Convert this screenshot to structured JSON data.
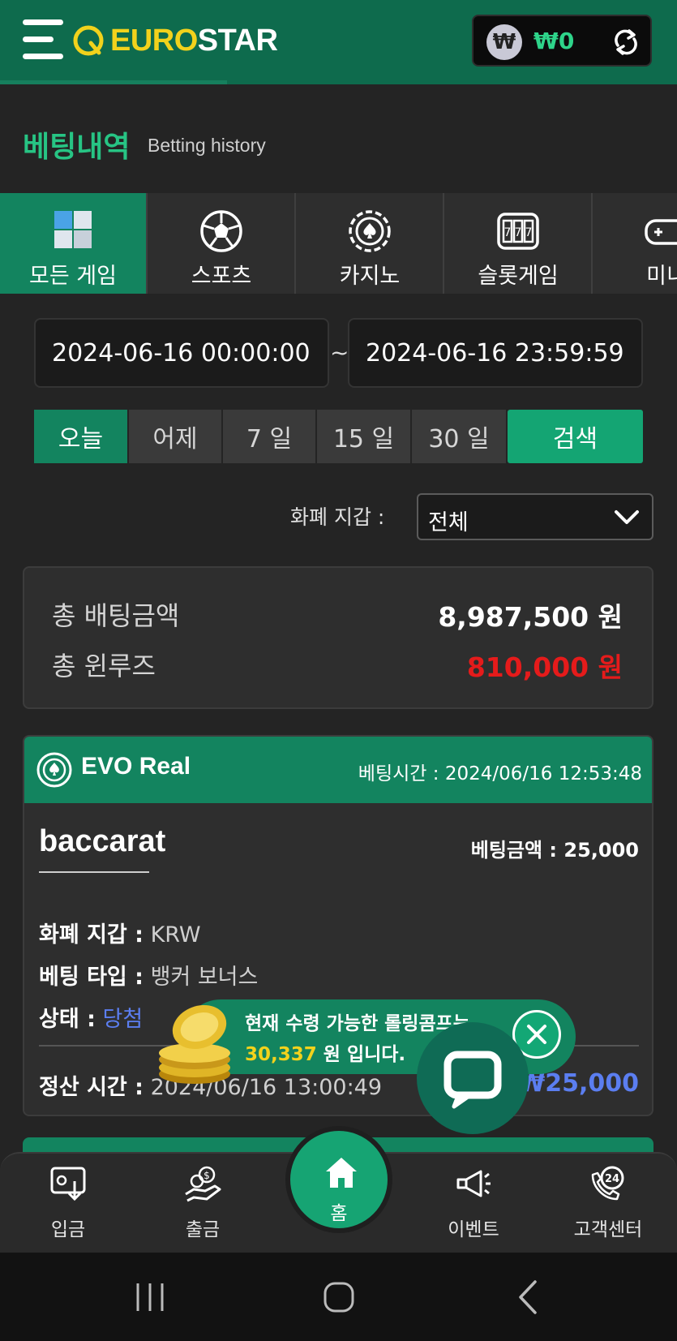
{
  "header": {
    "brand_prefix": "EURO",
    "brand_suffix": "STAR",
    "wallet_symbol": "₩",
    "wallet_balance": "₩0",
    "accent": "#13845f",
    "logo_color": "#f2d21c"
  },
  "page": {
    "title_ko": "베팅내역",
    "title_en": "Betting history"
  },
  "categories": [
    {
      "label": "모든 게임",
      "icon": "all-games-icon",
      "active": true
    },
    {
      "label": "스포츠",
      "icon": "soccer-ball-icon",
      "active": false
    },
    {
      "label": "카지노",
      "icon": "casino-chip-icon",
      "active": false
    },
    {
      "label": "슬롯게임",
      "icon": "slot-machine-icon",
      "active": false
    },
    {
      "label": "미니",
      "icon": "gamepad-icon",
      "active": false
    }
  ],
  "filters": {
    "date_from": "2024-06-16 00:00:00",
    "date_to": "2024-06-16 23:59:59",
    "tilde": "~",
    "periods": [
      "오늘",
      "어제",
      "7 일",
      "15 일",
      "30 일"
    ],
    "search_label": "검색",
    "currency_label": "화폐 지갑 :",
    "currency_value": "전체"
  },
  "summary": {
    "total_bet_label": "총 배팅금액",
    "total_bet_value": "8,987,500 원",
    "total_winloss_label": "총 윈루즈",
    "total_winloss_value": "810,000 원",
    "loss_color": "#e51b1b"
  },
  "bet": {
    "provider": "EVO Real",
    "bet_time_label": "베팅시간 :",
    "bet_time": "2024/06/16 12:53:48",
    "game": "baccarat",
    "amount_label": "베팅금액 :",
    "amount": "25,000",
    "currency_label": "화폐 지갑 :",
    "currency": "KRW",
    "type_label": "베팅 타입 :",
    "type": "뱅커 보너스",
    "status_label": "상태 :",
    "status": "당첨",
    "settle_label": "정산 시간 :",
    "settle_time": "2024/06/16 13:00:49",
    "payout": "₩25,000",
    "win_color": "#5b7ef0"
  },
  "banner": {
    "line1": "현재 수령 가능한 롤링콤프는",
    "amount": "30,337",
    "line2_suffix": "원 입니다."
  },
  "bottom_nav": {
    "deposit": "입금",
    "withdraw": "출금",
    "home": "홈",
    "event": "이벤트",
    "support": "고객센터"
  }
}
